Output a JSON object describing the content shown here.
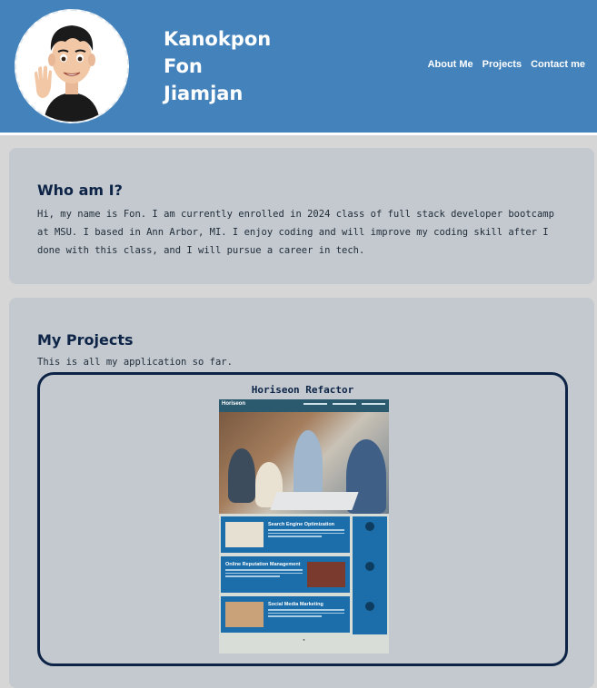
{
  "header": {
    "name_line1": "Kanokpon",
    "name_line2": "Fon",
    "name_line3": "Jiamjan",
    "nav": [
      "About Me",
      "Projects",
      "Contact me"
    ]
  },
  "about": {
    "heading": "Who am I?",
    "text": "Hi, my name is Fon. I am currently enrolled in 2024 class of full stack developer bootcamp at MSU. I based in Ann Arbor, MI. I enjoy coding and will improve my coding skill after I done with this class, and I will pursue a career in tech."
  },
  "projects": {
    "heading": "My Projects",
    "intro": "This is all my application so far.",
    "items": [
      {
        "title": "Horiseon Refactor",
        "thumb": {
          "logo": "Horiseon",
          "sections": [
            "Search Engine Optimization",
            "Online Reputation Management",
            "Social Media Marketing"
          ]
        }
      }
    ]
  },
  "colors": {
    "header_bg": "#4382bb",
    "card_bg": "#c3c9cf",
    "heading": "#0d2447",
    "page_bg": "#d6d6d6"
  }
}
